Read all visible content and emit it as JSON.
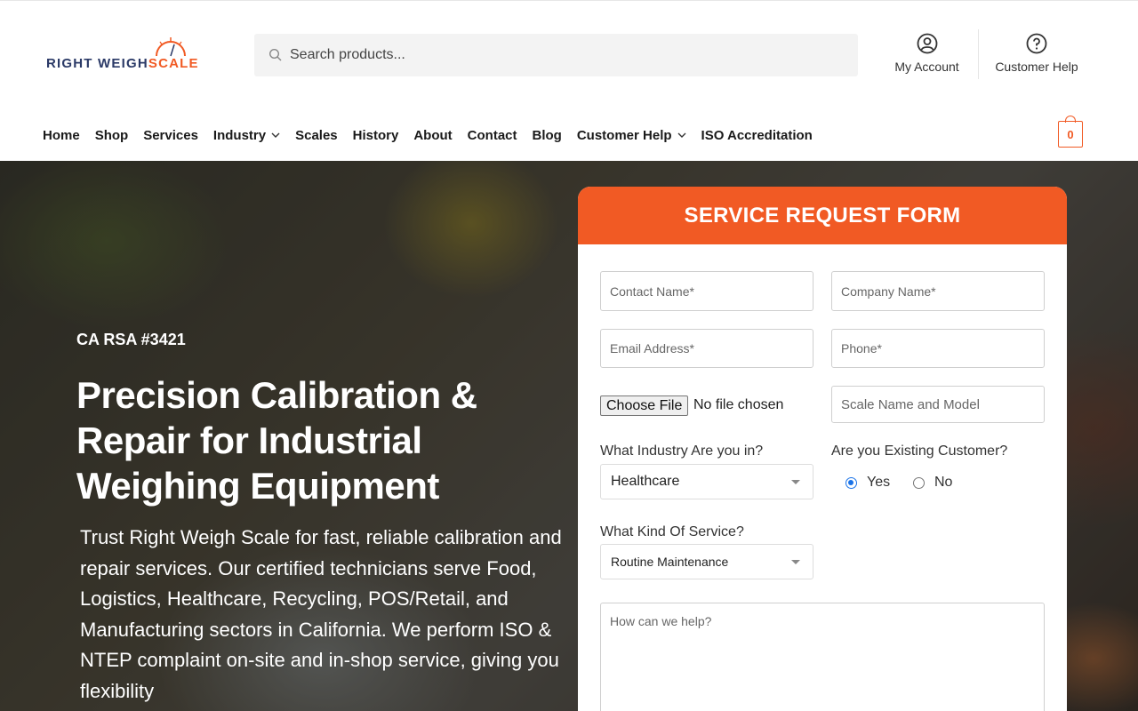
{
  "header": {
    "logo": {
      "part1": "RIGHT WEIGH",
      "part2": "SCALE"
    },
    "search": {
      "placeholder": "Search products..."
    },
    "account_label": "My Account",
    "help_label": "Customer Help",
    "cart_count": "0"
  },
  "nav": {
    "items": [
      {
        "label": "Home",
        "dropdown": false
      },
      {
        "label": "Shop",
        "dropdown": false
      },
      {
        "label": "Services",
        "dropdown": false
      },
      {
        "label": "Industry",
        "dropdown": true
      },
      {
        "label": "Scales",
        "dropdown": false
      },
      {
        "label": "History",
        "dropdown": false
      },
      {
        "label": "About",
        "dropdown": false
      },
      {
        "label": "Contact",
        "dropdown": false
      },
      {
        "label": "Blog",
        "dropdown": false
      },
      {
        "label": "Customer Help",
        "dropdown": true
      },
      {
        "label": "ISO Accreditation",
        "dropdown": false
      }
    ]
  },
  "hero": {
    "rsa": "CA RSA #3421",
    "headline": "Precision Calibration & Repair for Industrial Weighing Equipment",
    "description": "Trust Right Weigh Scale for fast, reliable calibration and repair services. Our certified technicians serve Food, Logistics, Healthcare, Recycling, POS/Retail, and Manufacturing sectors in California. We perform ISO & NTEP complaint on-site and in-shop service, giving you flexibility"
  },
  "form": {
    "title": "SERVICE REQUEST FORM",
    "contact_name_placeholder": "Contact Name*",
    "company_name_placeholder": "Company Name*",
    "email_placeholder": "Email Address*",
    "phone_placeholder": "Phone*",
    "file_button": "Choose File",
    "file_status": "No file chosen",
    "scale_placeholder": "Scale Name and Model",
    "industry_label": "What Industry Are you in?",
    "industry_value": "Healthcare",
    "existing_label": "Are you Existing Customer?",
    "existing_yes": "Yes",
    "existing_no": "No",
    "existing_selected": "Yes",
    "service_label": "What Kind Of Service?",
    "service_value": "Routine Maintenance",
    "message_placeholder": "How can we help?"
  },
  "colors": {
    "accent": "#f15a24",
    "navy": "#2b3a67"
  }
}
